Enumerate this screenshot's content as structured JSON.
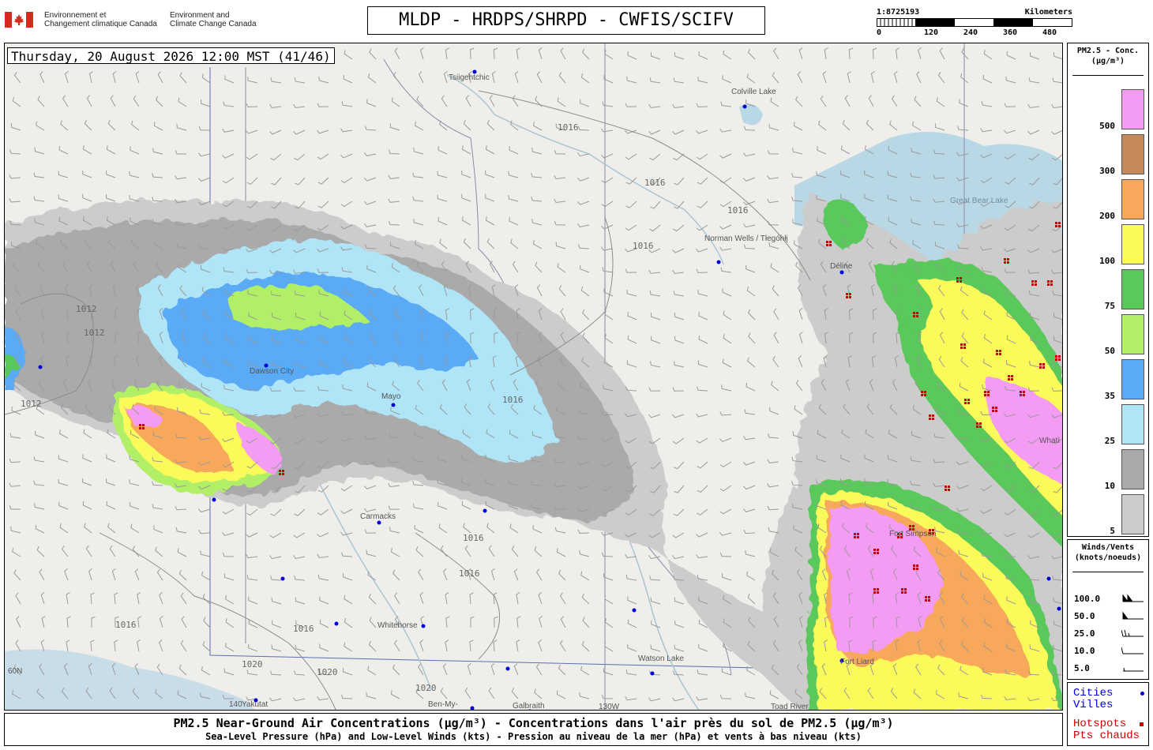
{
  "header": {
    "gov_fr_line1": "Environnement et",
    "gov_fr_line2": "Changement climatique Canada",
    "gov_en_line1": "Environment and",
    "gov_en_line2": "Climate Change Canada",
    "title": "MLDP - HRDPS/SHRPD - CWFIS/SCIFV"
  },
  "scale": {
    "ratio": "1:8725193",
    "unit": "Kilometers",
    "ticks": [
      "0",
      "120",
      "240",
      "360",
      "480"
    ]
  },
  "map": {
    "datetime": "Thursday, 20 August 2026 12:00 MST (41/46)",
    "place_labels": [
      "Tsiigehtchic",
      "Colville Lake",
      "Great Bear Lake",
      "Norman Wells / Tłegóhłį",
      "Déline",
      "Dawson City",
      "Mayo",
      "Carmacks",
      "Whitehorse",
      "Watson Lake",
      "Fort Simpson",
      "Fort Liard",
      "Whatì",
      "Yakutat",
      "Ben-My-",
      "Galbraith",
      "Toad River",
      "130W",
      "60N",
      "140"
    ],
    "isobar_labels": [
      "1016",
      "1012",
      "1020"
    ]
  },
  "legend": {
    "title_line1": "PM2.5 - Conc.",
    "title_line2": "(µg/m³)",
    "levels": [
      {
        "value": "500",
        "color": "#f49bf4"
      },
      {
        "value": "300",
        "color": "#c48a5a"
      },
      {
        "value": "200",
        "color": "#f7a85a"
      },
      {
        "value": "100",
        "color": "#fafa5a"
      },
      {
        "value": "75",
        "color": "#5ac85a"
      },
      {
        "value": "50",
        "color": "#b1f066"
      },
      {
        "value": "35",
        "color": "#5aaaf5"
      },
      {
        "value": "25",
        "color": "#b0e4f7"
      },
      {
        "value": "10",
        "color": "#aaaaaa"
      },
      {
        "value": "5",
        "color": "#cccccc"
      }
    ]
  },
  "winds": {
    "title_line1": "Winds/Vents",
    "title_line2": "(knots/noeuds)",
    "values": [
      "100.0",
      "50.0",
      "25.0",
      "10.0",
      "5.0"
    ]
  },
  "key": {
    "cities_en": "Cities",
    "cities_fr": "Villes",
    "hotspots_en": "Hotspots",
    "hotspots_fr": "Pts chauds",
    "city_color": "#0000dd",
    "hotspot_color": "#cc0000"
  },
  "footer": {
    "line1": "PM2.5 Near-Ground Air Concentrations (µg/m³) - Concentrations dans l'air près du sol de PM2.5 (µg/m³)",
    "line2": "Sea-Level Pressure (hPa) and Low-Level Winds (kts) - Pression au niveau de la mer (hPa) et vents à bas niveau (kts)"
  }
}
